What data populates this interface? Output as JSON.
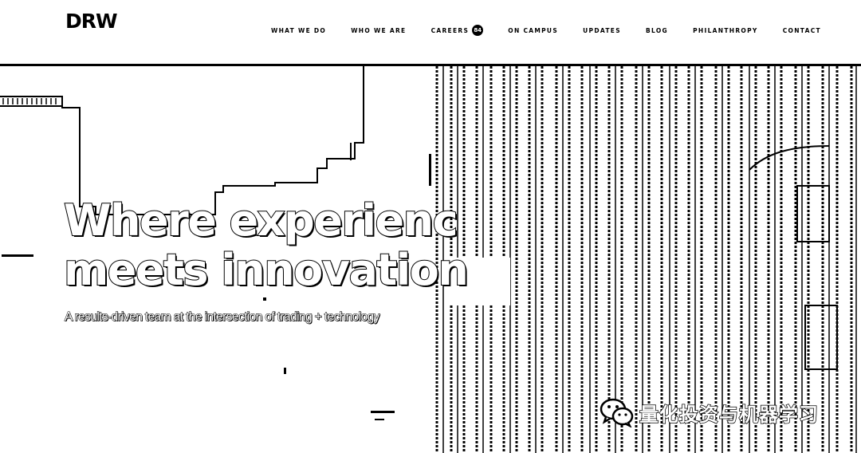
{
  "brand": {
    "logo_text": "DRW"
  },
  "nav": {
    "items": [
      {
        "label": "WHAT WE DO"
      },
      {
        "label": "WHO WE ARE"
      },
      {
        "label": "CAREERS",
        "badge": "84"
      },
      {
        "label": "ON CAMPUS"
      },
      {
        "label": "UPDATES"
      },
      {
        "label": "BLOG"
      },
      {
        "label": "PHILANTHROPY"
      },
      {
        "label": "CONTACT"
      }
    ]
  },
  "hero": {
    "headline_line1": "Where experienc",
    "headline_line2": "meets innovation",
    "subheadline": "A results-driven team at the intersection of trading + technology"
  },
  "watermark": {
    "text": "量化投资与机器学习",
    "icon": "wechat-icon"
  },
  "colors": {
    "text": "#000000",
    "background": "#ffffff"
  }
}
